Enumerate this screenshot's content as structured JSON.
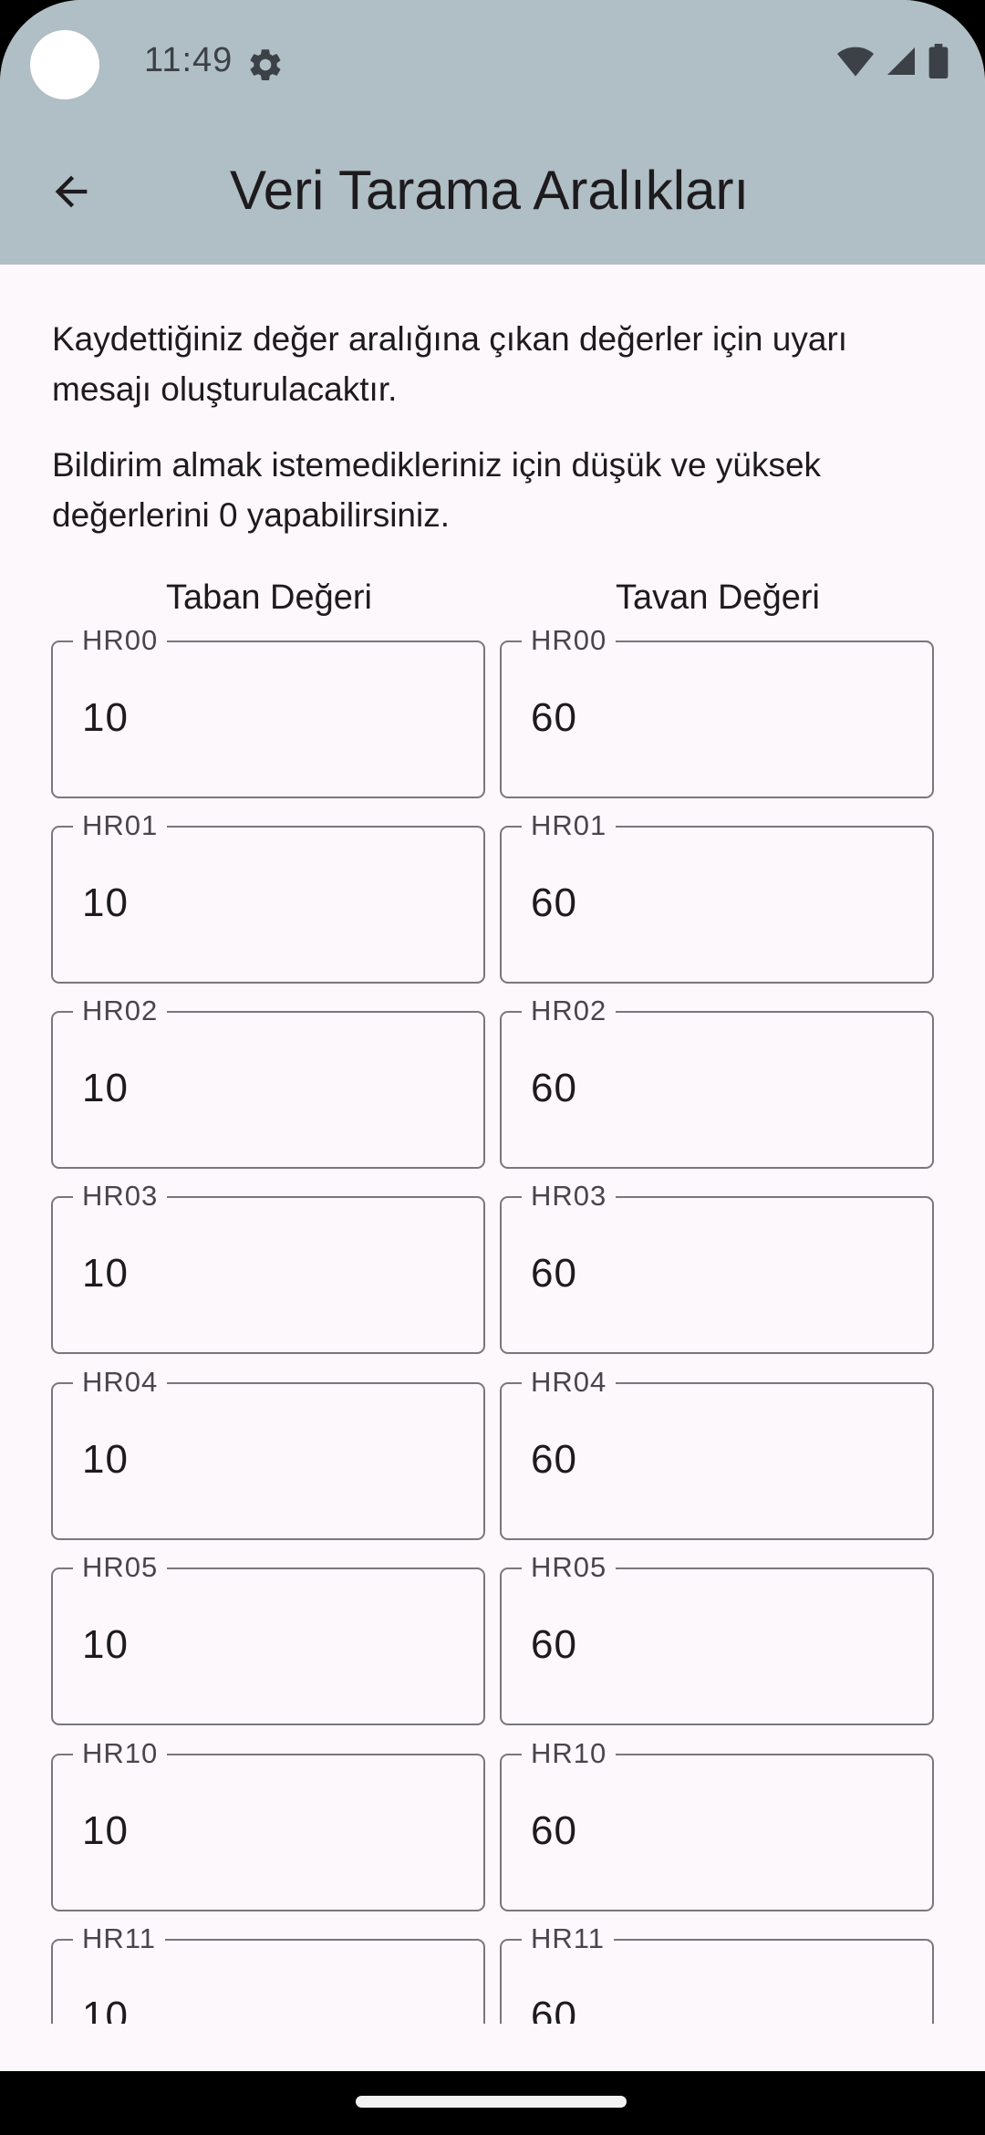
{
  "status_bar": {
    "time": "11:49",
    "icons": [
      "settings-icon",
      "wifi-icon",
      "signal-icon",
      "battery-icon"
    ]
  },
  "app_bar": {
    "back_icon": "arrow-back-icon",
    "title": "Veri Tarama Aralıkları",
    "background_color": "#b0bec5"
  },
  "intro": {
    "line_1": "Kaydettiğiniz değer aralığına çıkan değerler için uyarı mesajı oluşturulacaktır.",
    "line_2": "Bildirim almak istemedikleriniz için düşük ve yüksek değerlerini 0 yapabilirsiniz."
  },
  "columns": {
    "min_header": "Taban Değeri",
    "max_header": "Tavan Değeri"
  },
  "rows": [
    {
      "label": "HR00",
      "min": "10",
      "max": "60"
    },
    {
      "label": "HR01",
      "min": "10",
      "max": "60"
    },
    {
      "label": "HR02",
      "min": "10",
      "max": "60"
    },
    {
      "label": "HR03",
      "min": "10",
      "max": "60"
    },
    {
      "label": "HR04",
      "min": "10",
      "max": "60"
    },
    {
      "label": "HR05",
      "min": "10",
      "max": "60"
    },
    {
      "label": "HR10",
      "min": "10",
      "max": "60"
    },
    {
      "label": "HR11",
      "min": "10",
      "max": "60"
    }
  ]
}
